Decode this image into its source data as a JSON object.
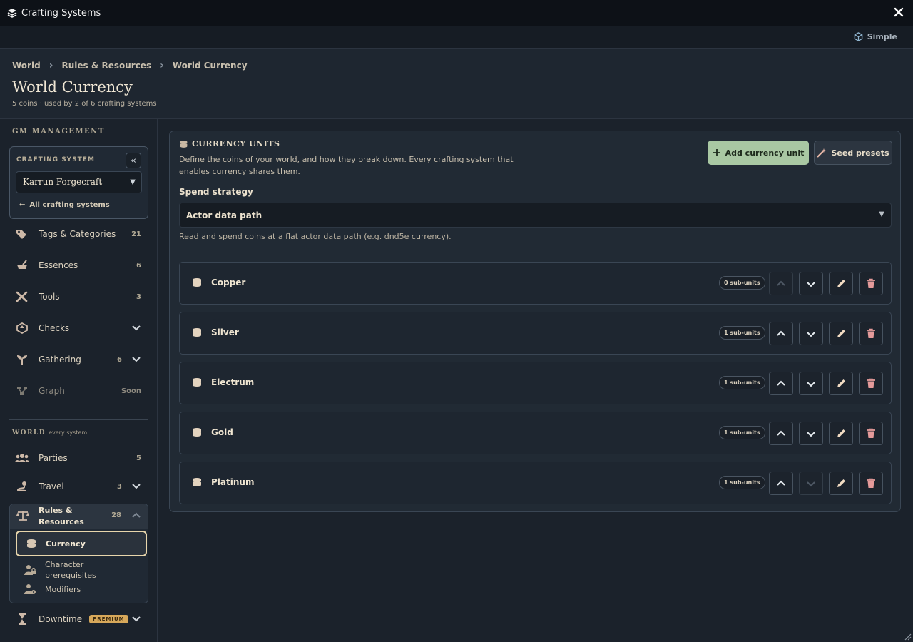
{
  "window": {
    "title": "Crafting Systems"
  },
  "mode": {
    "label": "Simple"
  },
  "breadcrumb": [
    "World",
    "Rules & Resources",
    "World Currency"
  ],
  "page": {
    "title": "World Currency",
    "subtitle": "5 coins · used by 2 of 6 crafting systems"
  },
  "sidebar": {
    "section_gm": "GM MANAGEMENT",
    "crafting_system_label": "CRAFTING SYSTEM",
    "selected_system": "Karrun Forgecraft",
    "all_systems_link": "All crafting systems",
    "items": [
      {
        "label": "Tags & Categories",
        "count": "21",
        "icon": "tag-icon"
      },
      {
        "label": "Essences",
        "count": "6",
        "icon": "mortar-icon"
      },
      {
        "label": "Tools",
        "count": "3",
        "icon": "tools-icon"
      },
      {
        "label": "Checks",
        "icon": "dice-icon"
      },
      {
        "label": "Gathering",
        "count": "6",
        "icon": "sprout-icon"
      },
      {
        "label": "Graph",
        "count": "Soon",
        "icon": "graph-icon"
      }
    ],
    "section_world": "WORLD",
    "section_world_sub": "every system",
    "world_items": [
      {
        "label": "Parties",
        "count": "5",
        "icon": "people-icon"
      },
      {
        "label": "Travel",
        "count": "3",
        "icon": "route-icon"
      }
    ],
    "rules": {
      "label_line1": "Rules &",
      "label_line2": "Resources",
      "count": "28",
      "children": [
        {
          "label": "Currency",
          "icon": "coins-icon"
        },
        {
          "label_line1": "Character",
          "label_line2": "prerequisites",
          "icon": "user-lock-icon"
        },
        {
          "label": "Modifiers",
          "icon": "user-gear-icon"
        }
      ]
    },
    "downtime": {
      "label": "Downtime",
      "badge": "PREMIUM"
    }
  },
  "main": {
    "title": "CURRENCY UNITS",
    "desc_line1": "Define the coins of your world, and how they break down. Every crafting system that",
    "desc_line2": "enables currency shares them.",
    "add_button": "Add currency unit",
    "seed_button": "Seed presets",
    "spend_label": "Spend strategy",
    "spend_value": "Actor data path",
    "spend_help": "Read and spend coins at a flat actor data path (e.g. dnd5e currency).",
    "units": [
      {
        "name": "Copper",
        "badge": "0 sub-units"
      },
      {
        "name": "Silver",
        "badge": "1 sub-units"
      },
      {
        "name": "Electrum",
        "badge": "1 sub-units"
      },
      {
        "name": "Gold",
        "badge": "1 sub-units"
      },
      {
        "name": "Platinum",
        "badge": "1 sub-units"
      }
    ]
  },
  "colors": {
    "accent_green": "#a9c8a3",
    "premium": "#d7a85a",
    "delete": "#e59a9a",
    "active_border": "#e8d6ac"
  }
}
